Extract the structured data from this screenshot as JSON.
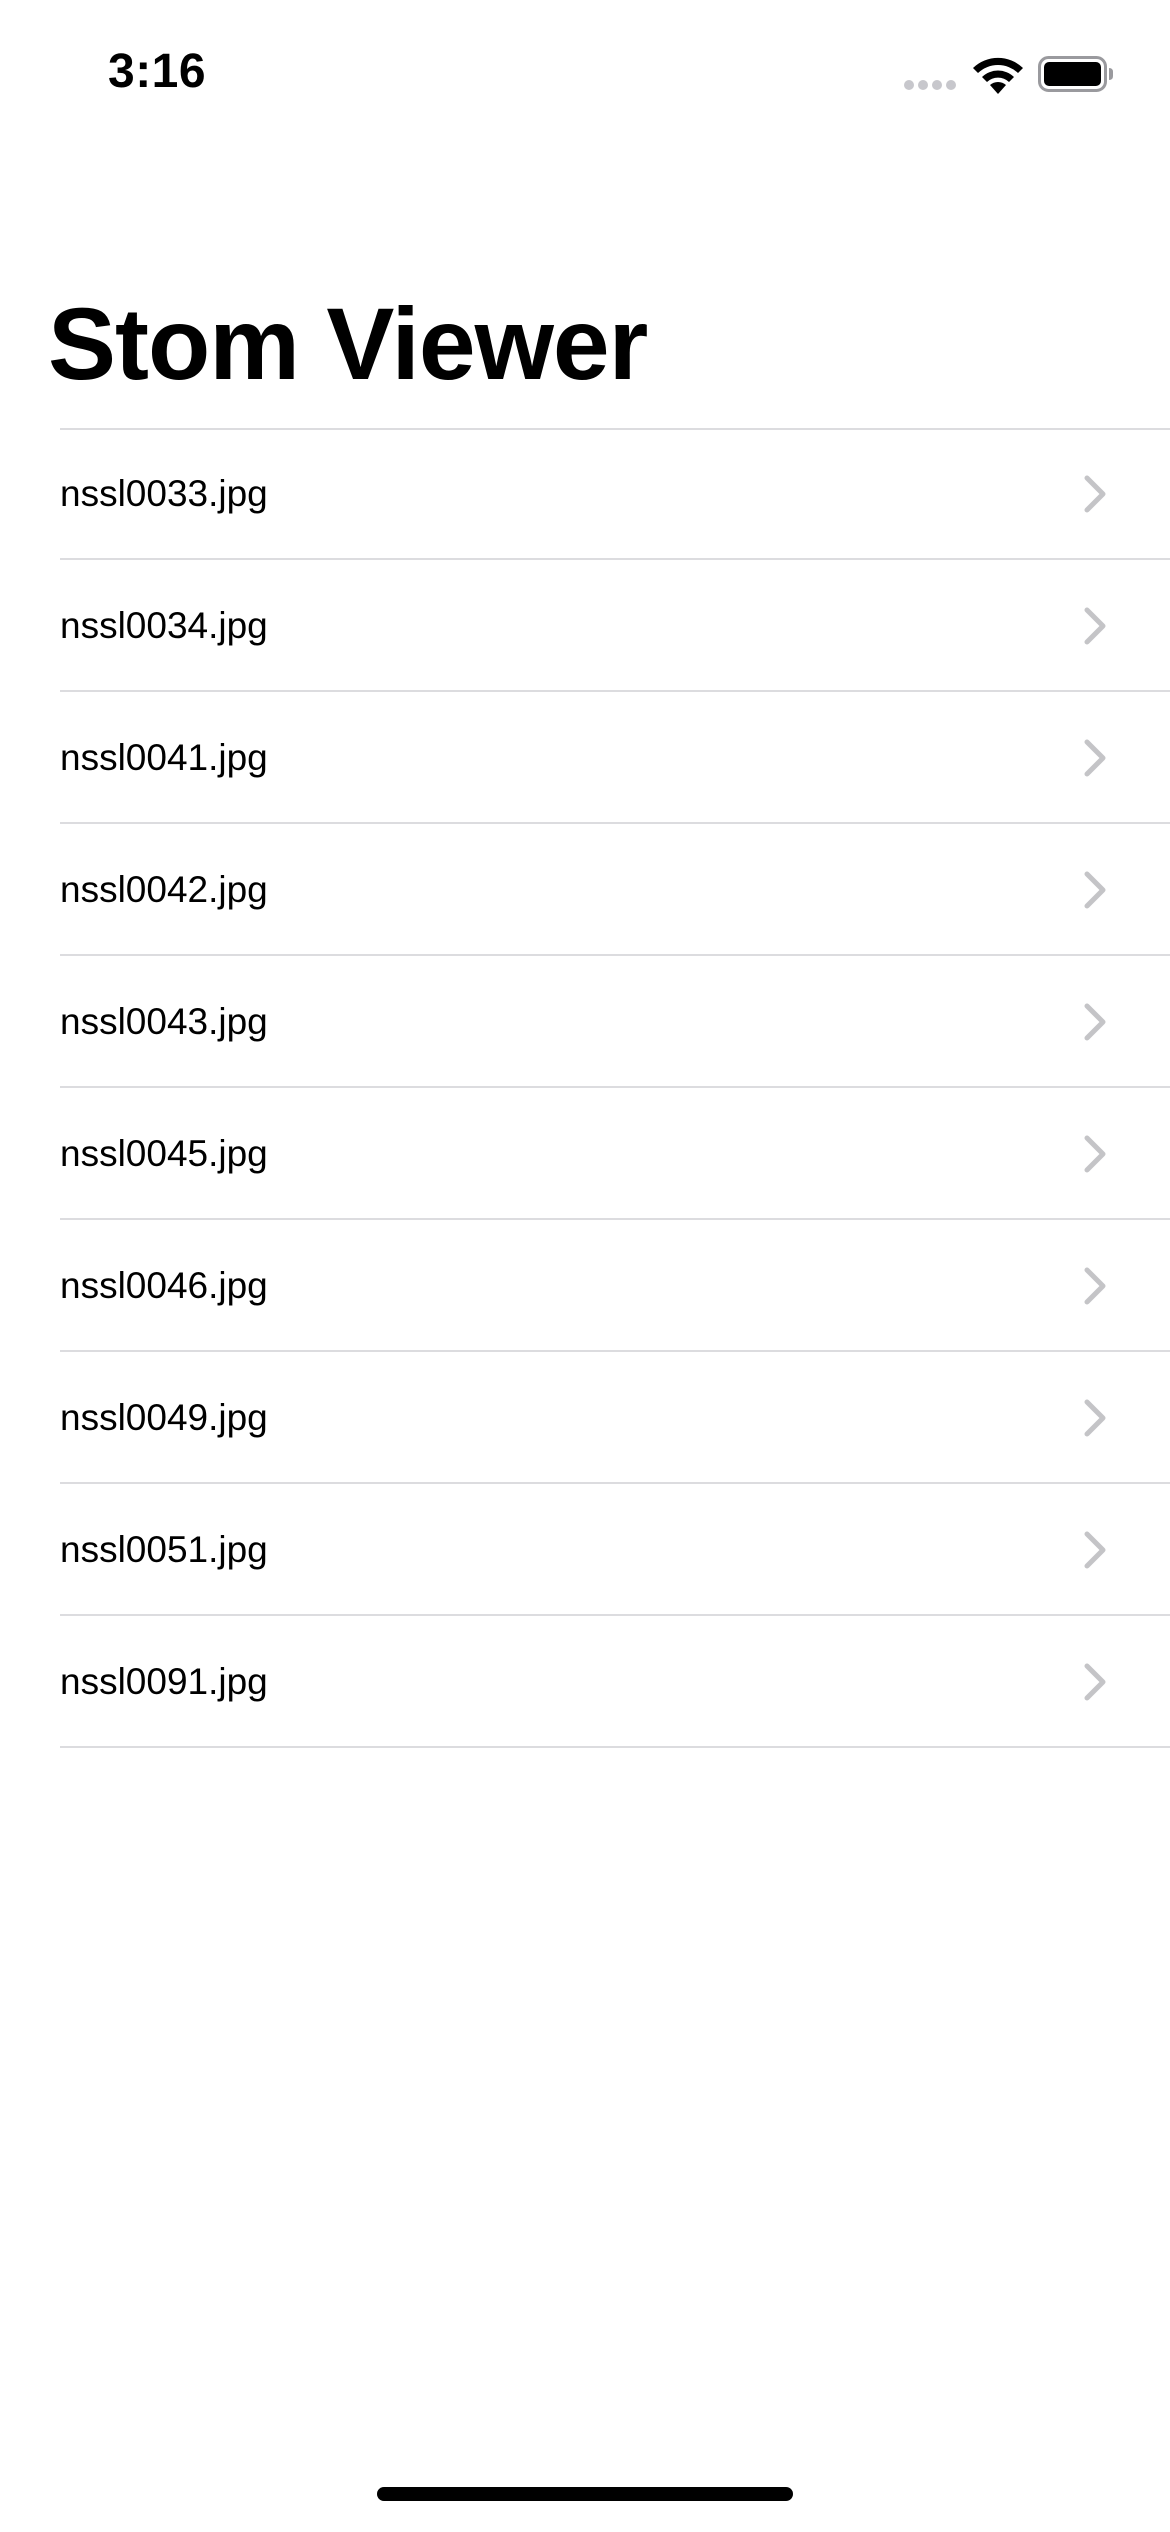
{
  "status_bar": {
    "time": "3:16",
    "signal_icon": "cellular-signal-icon",
    "wifi_icon": "wifi-icon",
    "battery_icon": "battery-icon"
  },
  "navigation": {
    "title": "Stom Viewer"
  },
  "list": {
    "items": [
      {
        "label": "nssl0033.jpg",
        "icon": "chevron-right-icon"
      },
      {
        "label": "nssl0034.jpg",
        "icon": "chevron-right-icon"
      },
      {
        "label": "nssl0041.jpg",
        "icon": "chevron-right-icon"
      },
      {
        "label": "nssl0042.jpg",
        "icon": "chevron-right-icon"
      },
      {
        "label": "nssl0043.jpg",
        "icon": "chevron-right-icon"
      },
      {
        "label": "nssl0045.jpg",
        "icon": "chevron-right-icon"
      },
      {
        "label": "nssl0046.jpg",
        "icon": "chevron-right-icon"
      },
      {
        "label": "nssl0049.jpg",
        "icon": "chevron-right-icon"
      },
      {
        "label": "nssl0051.jpg",
        "icon": "chevron-right-icon"
      },
      {
        "label": "nssl0091.jpg",
        "icon": "chevron-right-icon"
      }
    ]
  },
  "colors": {
    "background": "#ffffff",
    "text": "#000000",
    "separator": "#dcdcdf",
    "chevron": "#c4c4c7"
  }
}
